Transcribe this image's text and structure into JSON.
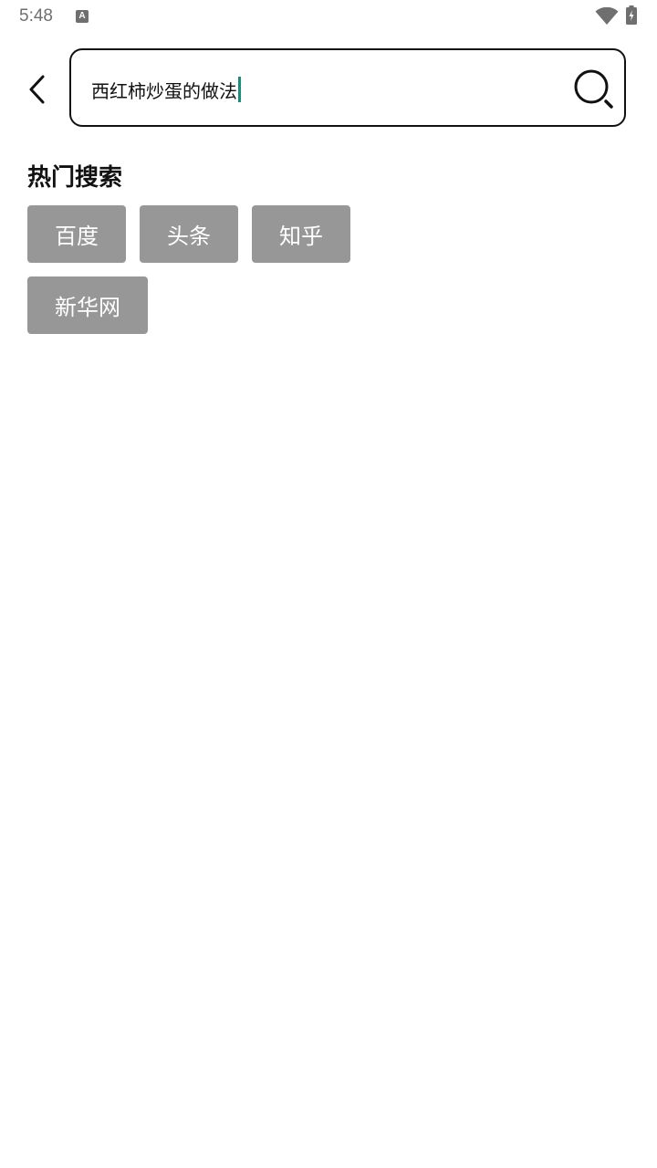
{
  "status_bar": {
    "time": "5:48",
    "app_icon_letter": "A",
    "icons": [
      "app-notification-icon",
      "wifi-icon",
      "battery-charging-icon"
    ]
  },
  "header": {
    "back_icon": "chevron-left-icon",
    "search": {
      "value": "西红柿炒蛋的做法",
      "icon": "search-icon"
    }
  },
  "hot_search": {
    "title": "热门搜索",
    "tags": [
      {
        "label": "百度"
      },
      {
        "label": "头条"
      },
      {
        "label": "知乎"
      },
      {
        "label": "新华网"
      }
    ]
  },
  "colors": {
    "tag_bg": "#979797",
    "caret": "#1b8c7d",
    "status_gray": "#6f6f6f"
  }
}
